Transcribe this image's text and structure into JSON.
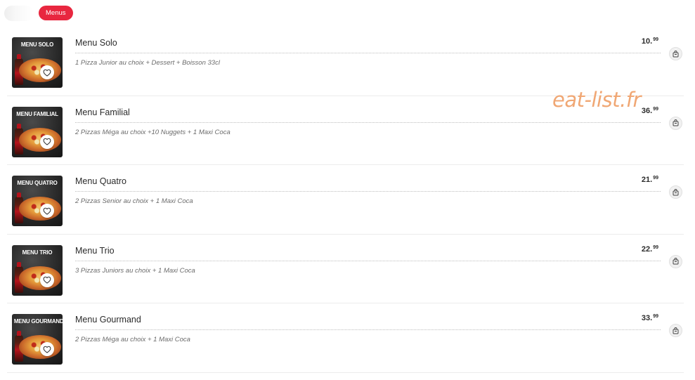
{
  "tabs": {
    "active_label": "Menus"
  },
  "watermark": "eat-list.fr",
  "items": [
    {
      "thumb_title": "MENU SOLO",
      "name": "Menu Solo",
      "price_main": "10.",
      "price_cents": "99",
      "description": "1 Pizza Junior au choix + Dessert + Boisson 33cl"
    },
    {
      "thumb_title": "MENU FAMILIAL",
      "name": "Menu Familial",
      "price_main": "36.",
      "price_cents": "99",
      "description": "2 Pizzas Méga au choix +10 Nuggets + 1 Maxi Coca"
    },
    {
      "thumb_title": "MENU QUATRO",
      "name": "Menu Quatro",
      "price_main": "21.",
      "price_cents": "99",
      "description": "2 Pizzas Senior au choix + 1 Maxi Coca"
    },
    {
      "thumb_title": "MENU TRIO",
      "name": "Menu Trio",
      "price_main": "22.",
      "price_cents": "99",
      "description": "3 Pizzas Juniors au choix + 1 Maxi Coca"
    },
    {
      "thumb_title": "MENU GOURMAND",
      "name": "Menu Gourmand",
      "price_main": "33.",
      "price_cents": "99",
      "description": "2 Pizzas Méga au choix + 1 Maxi Coca"
    }
  ],
  "icons": {
    "favorite": "heart-icon",
    "add_to_cart": "cart-icon"
  },
  "colors": {
    "accent": "#e8273f",
    "watermark": "#f0a774"
  }
}
